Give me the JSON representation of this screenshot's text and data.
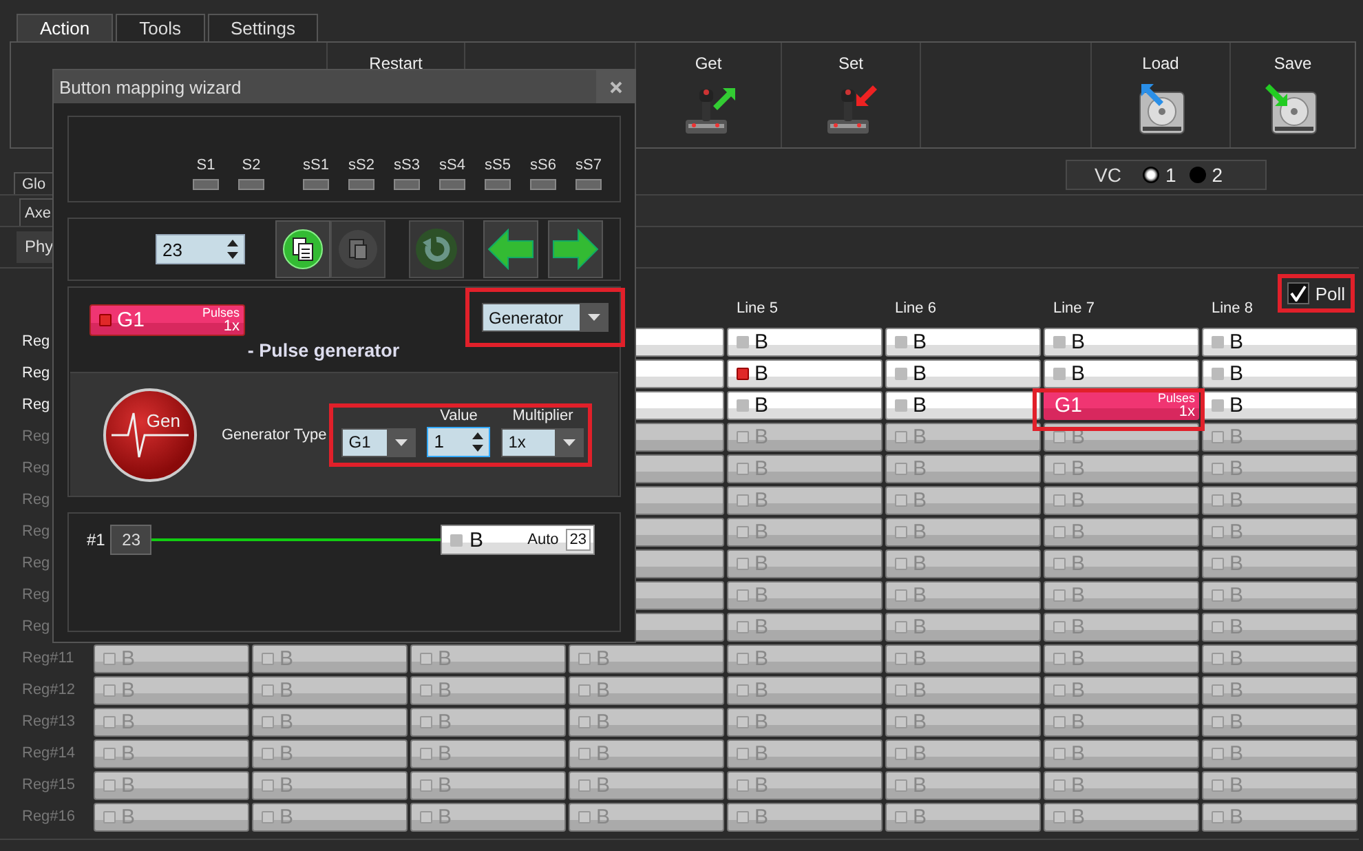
{
  "tabs": [
    {
      "label": "Action",
      "selected": true
    },
    {
      "label": "Tools",
      "selected": false
    },
    {
      "label": "Settings",
      "selected": false
    }
  ],
  "toolbar": [
    {
      "kind": "plain",
      "label": "Restart"
    },
    {
      "kind": "blank"
    },
    {
      "kind": "get",
      "label": "Get"
    },
    {
      "kind": "set",
      "label": "Set"
    },
    {
      "kind": "blank"
    },
    {
      "kind": "load",
      "label": "Load"
    },
    {
      "kind": "save",
      "label": "Save"
    }
  ],
  "vc": {
    "label": "VC",
    "options": [
      {
        "label": "1",
        "selected": true
      },
      {
        "label": "2",
        "selected": false
      }
    ]
  },
  "side_tabs": [
    {
      "label": "Glo",
      "selected": false
    },
    {
      "label": "Axe",
      "selected": false
    },
    {
      "label": "Phy",
      "selected": true
    }
  ],
  "poll": {
    "label": "Poll",
    "checked": true,
    "highlighted": true
  },
  "grid": {
    "columns": [
      "",
      "Line 5",
      "Line 6",
      "Line 7",
      "Line 8"
    ],
    "rows": [
      {
        "label": "Reg",
        "enabled": true,
        "cells": [
          {
            "kind": "blank"
          },
          {
            "kind": "button",
            "text": "B",
            "led": false
          },
          {
            "kind": "button",
            "text": "B",
            "led": false
          },
          {
            "kind": "button",
            "text": "B",
            "led": false
          },
          {
            "kind": "button",
            "text": "B",
            "led": false
          }
        ]
      },
      {
        "label": "Reg",
        "enabled": true,
        "cells": [
          {
            "kind": "blank"
          },
          {
            "kind": "button",
            "text": "B",
            "led": true
          },
          {
            "kind": "button",
            "text": "B",
            "led": false
          },
          {
            "kind": "button",
            "text": "B",
            "led": false
          },
          {
            "kind": "button",
            "text": "B",
            "led": false
          }
        ]
      },
      {
        "label": "Reg",
        "enabled": true,
        "cells": [
          {
            "kind": "blank"
          },
          {
            "kind": "button",
            "text": "B",
            "led": false
          },
          {
            "kind": "button",
            "text": "B",
            "led": false
          },
          {
            "kind": "pulse",
            "text": "G1",
            "caption": "Pulses",
            "multiplier": "1x",
            "highlighted": true
          },
          {
            "kind": "button",
            "text": "B",
            "led": false
          }
        ]
      },
      {
        "label": "Reg",
        "enabled": false,
        "cells": [
          {
            "kind": "blank"
          },
          {
            "kind": "button",
            "text": "B",
            "led": false
          },
          {
            "kind": "button",
            "text": "B",
            "led": false
          },
          {
            "kind": "button",
            "text": "B",
            "led": false
          },
          {
            "kind": "button",
            "text": "B",
            "led": false
          }
        ]
      },
      {
        "label": "Reg",
        "enabled": false,
        "cells": [
          {
            "kind": "blank"
          },
          {
            "kind": "button",
            "text": "B",
            "led": false
          },
          {
            "kind": "button",
            "text": "B",
            "led": false
          },
          {
            "kind": "button",
            "text": "B",
            "led": false
          },
          {
            "kind": "button",
            "text": "B",
            "led": false
          }
        ]
      },
      {
        "label": "Reg",
        "enabled": false,
        "cells": [
          {
            "kind": "blank"
          },
          {
            "kind": "button",
            "text": "B",
            "led": false
          },
          {
            "kind": "button",
            "text": "B",
            "led": false
          },
          {
            "kind": "button",
            "text": "B",
            "led": false
          },
          {
            "kind": "button",
            "text": "B",
            "led": false
          }
        ]
      },
      {
        "label": "Reg",
        "enabled": false,
        "cells": [
          {
            "kind": "blank"
          },
          {
            "kind": "button",
            "text": "B",
            "led": false
          },
          {
            "kind": "button",
            "text": "B",
            "led": false
          },
          {
            "kind": "button",
            "text": "B",
            "led": false
          },
          {
            "kind": "button",
            "text": "B",
            "led": false
          }
        ]
      },
      {
        "label": "Reg",
        "enabled": false,
        "cells": [
          {
            "kind": "blank"
          },
          {
            "kind": "button",
            "text": "B",
            "led": false
          },
          {
            "kind": "button",
            "text": "B",
            "led": false
          },
          {
            "kind": "button",
            "text": "B",
            "led": false
          },
          {
            "kind": "button",
            "text": "B",
            "led": false
          }
        ]
      },
      {
        "label": "Reg",
        "enabled": false,
        "cells": [
          {
            "kind": "blank"
          },
          {
            "kind": "button",
            "text": "B",
            "led": false
          },
          {
            "kind": "button",
            "text": "B",
            "led": false
          },
          {
            "kind": "button",
            "text": "B",
            "led": false
          },
          {
            "kind": "button",
            "text": "B",
            "led": false
          }
        ]
      },
      {
        "label": "Reg",
        "enabled": false,
        "cells": [
          {
            "kind": "blank"
          },
          {
            "kind": "button",
            "text": "B",
            "led": false
          },
          {
            "kind": "button",
            "text": "B",
            "led": false
          },
          {
            "kind": "button",
            "text": "B",
            "led": false
          },
          {
            "kind": "button",
            "text": "B",
            "led": false
          }
        ]
      },
      {
        "label": "Reg#11",
        "enabled": false,
        "cells": [
          {
            "kind": "button",
            "text": "B",
            "led": false
          },
          {
            "kind": "button",
            "text": "B",
            "led": false
          },
          {
            "kind": "button",
            "text": "B",
            "led": false
          },
          {
            "kind": "button",
            "text": "B",
            "led": false
          },
          {
            "kind": "button",
            "text": "B",
            "led": false
          },
          {
            "kind": "button",
            "text": "B",
            "led": false
          },
          {
            "kind": "button",
            "text": "B",
            "led": false
          },
          {
            "kind": "button",
            "text": "B",
            "led": false
          }
        ]
      },
      {
        "label": "Reg#12",
        "enabled": false,
        "cells": [
          {
            "kind": "button",
            "text": "B",
            "led": false
          },
          {
            "kind": "button",
            "text": "B",
            "led": false
          },
          {
            "kind": "button",
            "text": "B",
            "led": false
          },
          {
            "kind": "button",
            "text": "B",
            "led": false
          },
          {
            "kind": "button",
            "text": "B",
            "led": false
          },
          {
            "kind": "button",
            "text": "B",
            "led": false
          },
          {
            "kind": "button",
            "text": "B",
            "led": false
          },
          {
            "kind": "button",
            "text": "B",
            "led": false
          }
        ]
      },
      {
        "label": "Reg#13",
        "enabled": false,
        "cells": [
          {
            "kind": "button",
            "text": "B",
            "led": false
          },
          {
            "kind": "button",
            "text": "B",
            "led": false
          },
          {
            "kind": "button",
            "text": "B",
            "led": false
          },
          {
            "kind": "button",
            "text": "B",
            "led": false
          },
          {
            "kind": "button",
            "text": "B",
            "led": false
          },
          {
            "kind": "button",
            "text": "B",
            "led": false
          },
          {
            "kind": "button",
            "text": "B",
            "led": false
          },
          {
            "kind": "button",
            "text": "B",
            "led": false
          }
        ]
      },
      {
        "label": "Reg#14",
        "enabled": false,
        "cells": [
          {
            "kind": "button",
            "text": "B",
            "led": false
          },
          {
            "kind": "button",
            "text": "B",
            "led": false
          },
          {
            "kind": "button",
            "text": "B",
            "led": false
          },
          {
            "kind": "button",
            "text": "B",
            "led": false
          },
          {
            "kind": "button",
            "text": "B",
            "led": false
          },
          {
            "kind": "button",
            "text": "B",
            "led": false
          },
          {
            "kind": "button",
            "text": "B",
            "led": false
          },
          {
            "kind": "button",
            "text": "B",
            "led": false
          }
        ]
      },
      {
        "label": "Reg#15",
        "enabled": false,
        "cells": [
          {
            "kind": "button",
            "text": "B",
            "led": false
          },
          {
            "kind": "button",
            "text": "B",
            "led": false
          },
          {
            "kind": "button",
            "text": "B",
            "led": false
          },
          {
            "kind": "button",
            "text": "B",
            "led": false
          },
          {
            "kind": "button",
            "text": "B",
            "led": false
          },
          {
            "kind": "button",
            "text": "B",
            "led": false
          },
          {
            "kind": "button",
            "text": "B",
            "led": false
          },
          {
            "kind": "button",
            "text": "B",
            "led": false
          }
        ]
      },
      {
        "label": "Reg#16",
        "enabled": false,
        "cells": [
          {
            "kind": "button",
            "text": "B",
            "led": false
          },
          {
            "kind": "button",
            "text": "B",
            "led": false
          },
          {
            "kind": "button",
            "text": "B",
            "led": false
          },
          {
            "kind": "button",
            "text": "B",
            "led": false
          },
          {
            "kind": "button",
            "text": "B",
            "led": false
          },
          {
            "kind": "button",
            "text": "B",
            "led": false
          },
          {
            "kind": "button",
            "text": "B",
            "led": false
          },
          {
            "kind": "button",
            "text": "B",
            "led": false
          }
        ]
      }
    ]
  },
  "dialog": {
    "title": "Button mapping wizard",
    "shift_indicators": [
      "S1",
      "S2"
    ],
    "sub_indicators": [
      "sS1",
      "sS2",
      "sS3",
      "sS4",
      "sS5",
      "sS6",
      "sS7"
    ],
    "button_number": "23",
    "tools": [
      {
        "kind": "copy",
        "disabled": false
      },
      {
        "kind": "paste",
        "disabled": true
      },
      {
        "kind": "reset",
        "disabled": true
      },
      {
        "kind": "prev",
        "disabled": false
      },
      {
        "kind": "next",
        "disabled": false
      }
    ],
    "preview": {
      "text": "G1",
      "caption": "Pulses",
      "multiplier": "1x",
      "led": true
    },
    "mode": {
      "value": "Generator",
      "highlighted": true
    },
    "section_title": "- Pulse generator",
    "generator": {
      "icon_label": "Gen",
      "type_label": "Generator Type",
      "type": "G1",
      "value_label": "Value",
      "value": "1",
      "multiplier_label": "Multiplier",
      "multiplier": "1x",
      "highlighted": true
    },
    "mapping": {
      "index": "#1",
      "source": "23",
      "target": {
        "text": "B",
        "led": false,
        "mode": "Auto",
        "number": "23"
      }
    }
  }
}
